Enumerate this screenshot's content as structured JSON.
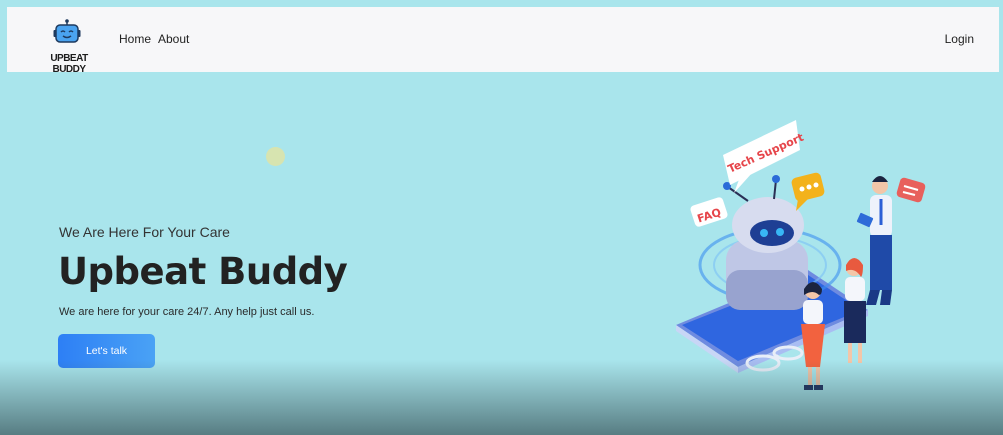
{
  "nav": {
    "brand": "UPBEAT BUDDY",
    "links": [
      {
        "label": "Home"
      },
      {
        "label": "About"
      }
    ],
    "login": "Login"
  },
  "hero": {
    "subtitle": "We Are Here For Your Care",
    "title": "Upbeat Buddy",
    "description": "We are here for your care 24/7. Any help just call us.",
    "cta": "Let's talk"
  },
  "illustration": {
    "bubble_tech": "Tech Support",
    "bubble_faq": "FAQ"
  },
  "colors": {
    "background": "#a9e5ec",
    "navbar": "#f7f7f9",
    "cta_start": "#2d7ff5",
    "cta_end": "#4aa2f5"
  }
}
